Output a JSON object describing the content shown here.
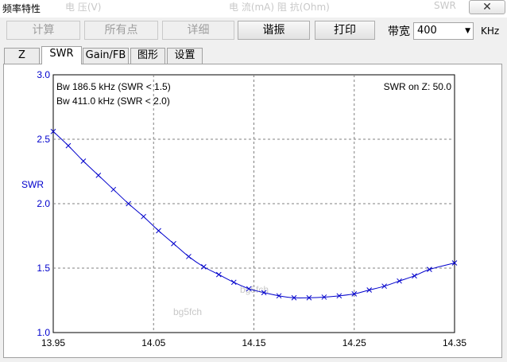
{
  "window": {
    "title": "频率特性",
    "ghost_header": [
      "电 压(V)",
      "电 流(mA) 阻 抗(Ohm)",
      "SWR"
    ]
  },
  "toolbar": {
    "calc_label": "计算",
    "all_points_label": "所有点",
    "details_label": "详细",
    "resonate_label": "谐振",
    "print_label": "打印",
    "bandwidth_label": "带宽",
    "bandwidth_value": "400",
    "bandwidth_unit": "KHz"
  },
  "tabs": [
    "Z",
    "SWR",
    "Gain/FB",
    "图形",
    "设置"
  ],
  "active_tab": "SWR",
  "colors": {
    "curve": "#0000cc",
    "grid": "#808080",
    "axis_text": "#0000cc",
    "watermark": "#c8c8c8"
  },
  "chart_data": {
    "type": "line",
    "title": "",
    "xlabel": "",
    "ylabel": "SWR",
    "xlim": [
      13.95,
      14.35
    ],
    "ylim": [
      1.0,
      3.0
    ],
    "x_ticks": [
      "13.95",
      "14.05",
      "14.15",
      "14.25",
      "14.35"
    ],
    "y_ticks": [
      "1.0",
      "1.5",
      "2.0",
      "2.5",
      "3.0"
    ],
    "grid": true,
    "annotations": {
      "bw1": "Bw 186.5 kHz (SWR < 1.5)",
      "bw2": "Bw 411.0 kHz (SWR < 2.0)",
      "swr_on_z": "SWR on Z: 50.0"
    },
    "watermark": "bg5fch",
    "series": [
      {
        "x": [
          13.95,
          13.965,
          13.98,
          13.995,
          14.01,
          14.025,
          14.04,
          14.055,
          14.07,
          14.085,
          14.1,
          14.115,
          14.13,
          14.145,
          14.16,
          14.175,
          14.19,
          14.205,
          14.22,
          14.235,
          14.25,
          14.265,
          14.28,
          14.295,
          14.31,
          14.325,
          14.35
        ],
        "values": [
          2.56,
          2.45,
          2.33,
          2.22,
          2.11,
          2.0,
          1.9,
          1.79,
          1.69,
          1.59,
          1.51,
          1.45,
          1.39,
          1.34,
          1.31,
          1.285,
          1.27,
          1.27,
          1.275,
          1.285,
          1.3,
          1.33,
          1.36,
          1.4,
          1.44,
          1.49,
          1.54
        ]
      }
    ],
    "markers_x": [
      13.95,
      13.965,
      13.98,
      13.995,
      14.01,
      14.025,
      14.04,
      14.055,
      14.07,
      14.085,
      14.1,
      14.115,
      14.13,
      14.145,
      14.16,
      14.175,
      14.19,
      14.205,
      14.22,
      14.235,
      14.25,
      14.265,
      14.28,
      14.295,
      14.31,
      14.325,
      14.35
    ]
  }
}
